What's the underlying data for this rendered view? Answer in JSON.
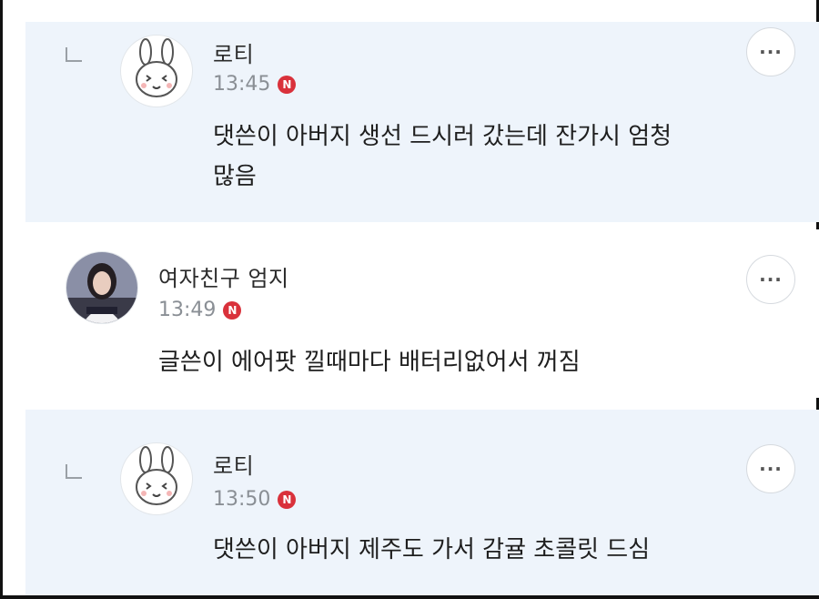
{
  "comments": [
    {
      "author": "로티",
      "time": "13:45",
      "badge": "N",
      "text": "댓쓴이 아버지 생선 드시러 갔는데 잔가시 엄청\n많음",
      "more_label": "···",
      "avatar_icon": "rabbit-avatar-icon"
    },
    {
      "author": "여자친구 엄지",
      "time": "13:49",
      "badge": "N",
      "text": "글쓴이 에어팟 낄때마다 배터리없어서 꺼짐",
      "more_label": "···",
      "avatar_icon": "profile-photo"
    },
    {
      "author": "로티",
      "time": "13:50",
      "badge": "N",
      "text": "댓쓴이 아버지 제주도 가서 감귤 초콜릿 드심",
      "more_label": "···",
      "avatar_icon": "rabbit-avatar-icon"
    }
  ],
  "colors": {
    "reply_background": "#eef4fb",
    "badge": "#d9313b",
    "time_text": "#8a8f95"
  }
}
